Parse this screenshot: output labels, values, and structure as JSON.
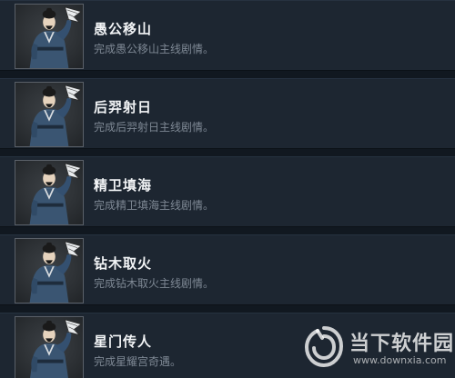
{
  "achievements": [
    {
      "title": "愚公移山",
      "description": "完成愚公移山主线剧情。",
      "icon": "scholar-portrait-icon"
    },
    {
      "title": "后羿射日",
      "description": "完成后羿射日主线剧情。",
      "icon": "scholar-portrait-icon"
    },
    {
      "title": "精卫填海",
      "description": "完成精卫填海主线剧情。",
      "icon": "scholar-portrait-icon"
    },
    {
      "title": "钻木取火",
      "description": "完成钻木取火主线剧情。",
      "icon": "scholar-portrait-icon"
    },
    {
      "title": "星门传人",
      "description": "完成星耀宫奇遇。",
      "icon": "scholar-portrait-icon"
    }
  ],
  "watermark": {
    "name": "当下软件园",
    "url": "www.downxia.com"
  },
  "colors": {
    "background": "#111820",
    "row": "#1d2631",
    "title": "#f2f4f6",
    "description": "#7e8894"
  }
}
